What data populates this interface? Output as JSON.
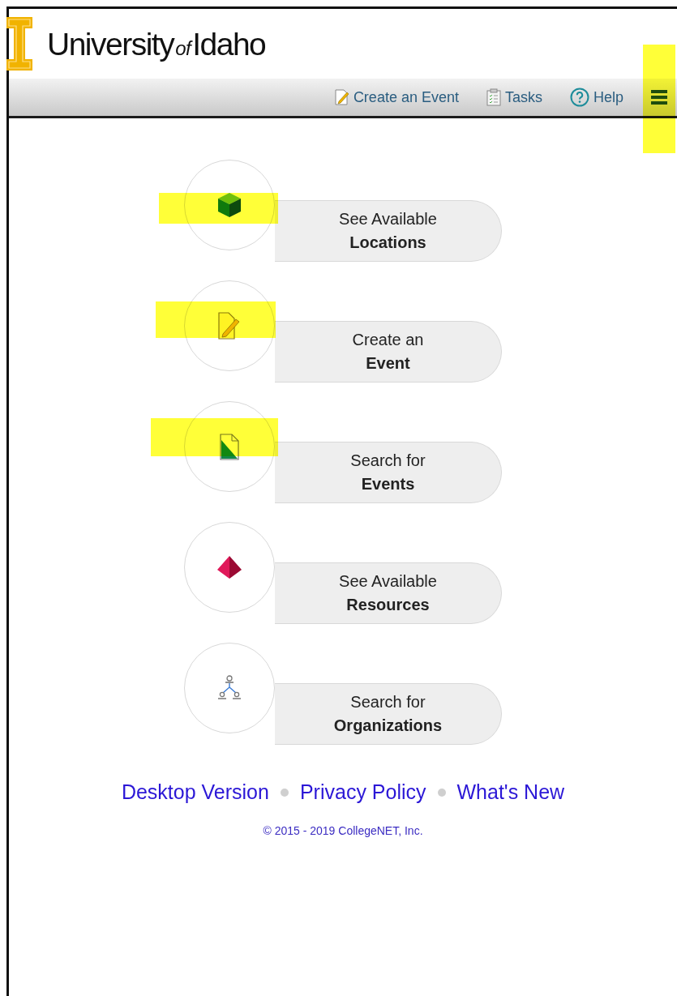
{
  "logo": {
    "word_1": "University",
    "word_2": "of",
    "word_3": "Idaho"
  },
  "nav": [
    {
      "kind": "create",
      "label": "Create an Event"
    },
    {
      "kind": "tasks",
      "label": "Tasks"
    },
    {
      "kind": "help",
      "label": "Help"
    }
  ],
  "menu_button": {
    "highlighted": true
  },
  "tiles": [
    {
      "kind": "locations",
      "line_1": "See Available",
      "line_2": "Locations",
      "highlighted": true
    },
    {
      "kind": "create",
      "line_1": "Create an",
      "line_2": "Event",
      "highlighted": true
    },
    {
      "kind": "search_events",
      "line_1": "Search for",
      "line_2": "Events",
      "highlighted": true
    },
    {
      "kind": "resources",
      "line_1": "See Available",
      "line_2": "Resources",
      "highlighted": false
    },
    {
      "kind": "organizations",
      "line_1": "Search for",
      "line_2": "Organizations",
      "highlighted": false
    }
  ],
  "footer": {
    "links": [
      "Desktop Version",
      "Privacy Policy",
      "What's New"
    ],
    "copyright": "© 2015 - 2019 CollegeNET, Inc."
  }
}
